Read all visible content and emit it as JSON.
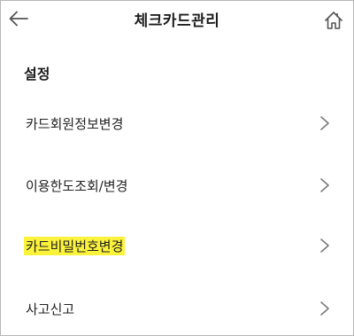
{
  "header": {
    "title": "체크카드관리",
    "back_icon": "back-arrow-icon",
    "home_icon": "home-icon"
  },
  "section": {
    "title": "설정"
  },
  "menu": {
    "items": [
      {
        "label": "카드회원정보변경",
        "highlighted": false
      },
      {
        "label": "이용한도조회/변경",
        "highlighted": false
      },
      {
        "label": "카드비밀번호변경",
        "highlighted": true
      },
      {
        "label": "사고신고",
        "highlighted": false
      }
    ]
  },
  "colors": {
    "highlight": "#fbf23c",
    "text": "#222222",
    "icon": "#555555",
    "chevron": "#7a7a7a"
  }
}
